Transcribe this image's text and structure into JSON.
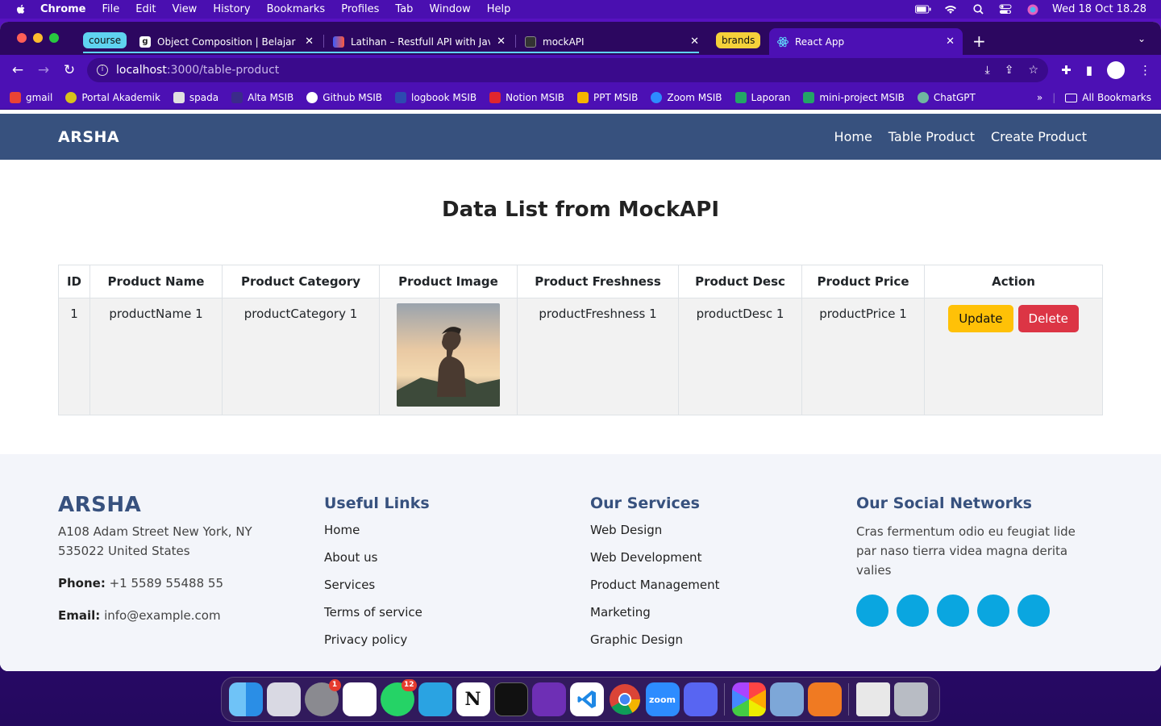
{
  "menubar": {
    "app": "Chrome",
    "items": [
      "File",
      "Edit",
      "View",
      "History",
      "Bookmarks",
      "Profiles",
      "Tab",
      "Window",
      "Help"
    ],
    "clock": "Wed 18 Oct  18.28"
  },
  "tabs": {
    "group_course": "course",
    "group_brands": "brands",
    "list": [
      {
        "title": "Object Composition | Belajar D"
      },
      {
        "title": "Latihan – Restfull API with Jav"
      },
      {
        "title": "mockAPI"
      },
      {
        "title": "React App"
      }
    ]
  },
  "omnibox": {
    "host": "localhost",
    "path": ":3000/table-product"
  },
  "bookmarks": {
    "items": [
      "gmail",
      "Portal Akademik",
      "spada",
      "Alta MSIB",
      "Github MSIB",
      "logbook MSIB",
      "Notion MSIB",
      "PPT MSIB",
      "Zoom MSIB",
      "Laporan",
      "mini-project MSIB",
      "ChatGPT"
    ],
    "overflow": "»",
    "all": "All Bookmarks"
  },
  "site": {
    "logo": "ARSHA",
    "nav": [
      "Home",
      "Table Product",
      "Create Product"
    ],
    "title": "Data List from MockAPI"
  },
  "table": {
    "headers": [
      "ID",
      "Product Name",
      "Product Category",
      "Product Image",
      "Product Freshness",
      "Product Desc",
      "Product Price",
      "Action"
    ],
    "rows": [
      {
        "id": "1",
        "name": "productName 1",
        "category": "productCategory 1",
        "freshness": "productFreshness 1",
        "desc": "productDesc 1",
        "price": "productPrice 1"
      }
    ],
    "update_label": "Update",
    "delete_label": "Delete"
  },
  "footer": {
    "brand": "ARSHA",
    "address_line1": "A108 Adam Street New York, NY",
    "address_line2": "535022 United States",
    "phone_label": "Phone:",
    "phone": "+1 5589 55488 55",
    "email_label": "Email:",
    "email": "info@example.com",
    "useful_title": "Useful Links",
    "useful_links": [
      "Home",
      "About us",
      "Services",
      "Terms of service",
      "Privacy policy"
    ],
    "services_title": "Our Services",
    "services": [
      "Web Design",
      "Web Development",
      "Product Management",
      "Marketing",
      "Graphic Design"
    ],
    "social_title": "Our Social Networks",
    "social_text": "Cras fermentum odio eu feugiat lide par naso tierra videa magna derita valies"
  },
  "dock": {
    "badges": {
      "settings": "1",
      "whatsapp": "12"
    },
    "zoom_label": "zoom"
  },
  "colors": {
    "brand": "#37517e",
    "social": "#0aa6e0",
    "update": "#ffc107",
    "delete": "#dc3545"
  }
}
